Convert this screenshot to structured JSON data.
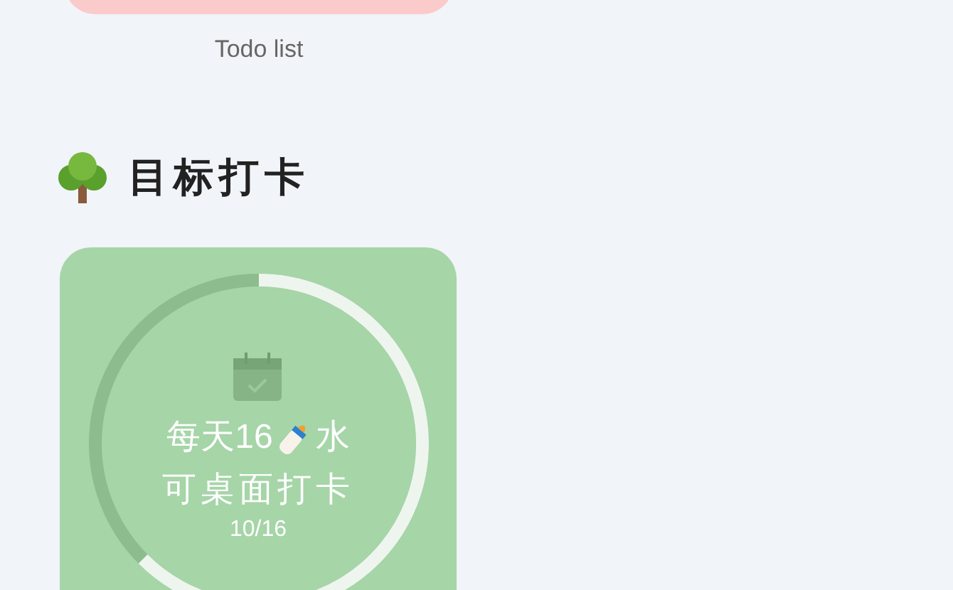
{
  "todo_card": {
    "caption": "Todo list"
  },
  "section": {
    "title": "目标打卡"
  },
  "goal_card": {
    "line_1_before_icon": "每天16",
    "line_1_after_icon": "水",
    "line_2": "可桌面打卡",
    "progress_text": "10/16"
  }
}
